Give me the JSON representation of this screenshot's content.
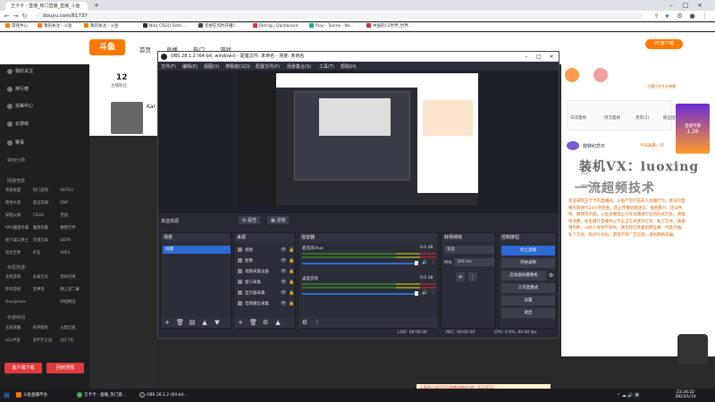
{
  "browser": {
    "tabs": [
      {
        "label": "王卡卡 - 直播_热门直播_直播_斗鱼",
        "active": true
      },
      {
        "label": "王卡卡 - 直播_热门直...",
        "active": false
      }
    ],
    "url": "douyu.com/61737",
    "bookmarks": [
      "游戏中心",
      "我的关注 - 斗鱼",
      "我的关注 - 斗鱼",
      "Nikz CSGO Setti...",
      "您想在何时开播?...",
      "Refrag | Dashboard",
      "Play - Teams - Ne...",
      "中国的CS世界_世界..."
    ]
  },
  "douyu": {
    "logo": "斗鱼",
    "nav": [
      "首页",
      "直播",
      "热门",
      "游戏"
    ],
    "sidebar": {
      "items": [
        "我的关注",
        "排行榜",
        "完美中心",
        "云游戏",
        "赛事"
      ],
      "sections": [
        "常用分类",
        "网游竞技",
        "单机热游",
        "手游休闲"
      ],
      "grid1": [
        "英雄联盟",
        "热门游戏",
        "DOTA2",
        "绝地大逃",
        "逃出深渊",
        "DNF",
        "穿越火线",
        "CSGO",
        "逆战",
        "RPG魔兽争霸",
        "魔兽争霸",
        "魔兽世界",
        "地下城与勇士",
        "守望先锋",
        "DOTA",
        "坦克世界",
        "炉石",
        "APEX"
      ],
      "grid2": [
        "主机游戏",
        "永劫无间",
        "使命召唤",
        "怀旧游戏",
        "黑神话",
        "晚上第二幕",
        "Overprime",
        "",
        "环绕精选"
      ],
      "grid3": [
        "王者荣耀",
        "和平精英",
        "火影忍者",
        "LOL手游",
        "金铲铲之战",
        "QQ飞车",
        "COD手游",
        "幻想飞行家",
        "CF手游"
      ],
      "buttons": [
        "客户端下载",
        "回到顶部"
      ]
    },
    "room": {
      "fans_count": "12",
      "fans_label": "主播粉丝",
      "host_name": "Kar..."
    },
    "right_panel": {
      "pc_badge": "PC客户端",
      "pc_sub": "主播正在开启弹幕",
      "tabs": [
        "日流量榜",
        "周流量榜",
        "贵宾(2)",
        "粉丝团"
      ],
      "rank_title": "旋转纪念日",
      "rank_sub": "今日再看一点",
      "user1": "pigff",
      "user2": "网络Along~",
      "watermark1": "装机VX：luoxing",
      "watermark2": "一流超频技术",
      "welcome": "欢迎来到王卡卡的直播间。斗鱼严厉打击非人主播行为，依法对直播内容进行24小时巡查，禁止传播封建迷信、低俗暴力、违法色情、赌博等内容。斗鱼主播禁止引导主播进行任何形式打赏。请理性消费，如主播在直播中以不正当方式诱导打赏、私下交易，请谨慎判断，以防人身财产损失。请勿轻信各类招聘征婚、代练代抽、私下交易、购买礼包码、游戏币等广告信息，谨防网络诈骗。",
      "side_badge": "直播专题",
      "side_badge_sub": "1.26"
    },
    "bottom_gift": "2.68关注成员可在直播间赠送礼物（01/2551）"
  },
  "obs": {
    "title": "OBS 28.1.2 (64-bit, windows) - 配置文件: 未命名 - 场景: 未命名",
    "menu": [
      "文件(F)",
      "编辑(E)",
      "视图(V)",
      "停靠窗口(D)",
      "配置文件(P)",
      "场景集合(S)",
      "工具(T)",
      "帮助(H)"
    ],
    "scene_bar": {
      "label": "未选择源",
      "props": "属性",
      "filters": "滤镜"
    },
    "docks": {
      "scenes": {
        "title": "场景",
        "items": [
          "场景"
        ]
      },
      "sources": {
        "title": "来源",
        "items": [
          "视频",
          "图像",
          "视频采集设备",
          "窗口采集",
          "显示器采集",
          "音频输出采集"
        ]
      },
      "mixer": {
        "title": "混音器",
        "ch1": "麦克风/Aux",
        "ch1_db": "0.0 dB",
        "ch2": "桌面音频",
        "ch2_db": "0.0 dB",
        "scale": [
          "-60",
          "-55",
          "-50",
          "-45",
          "-40",
          "-35",
          "-30",
          "-25",
          "-20",
          "-15",
          "-10",
          "-5",
          "0"
        ]
      },
      "transitions": {
        "title": "转场特效",
        "type": "渐变",
        "duration_label": "时长",
        "duration": "300 ms"
      },
      "controls": {
        "title": "控制按钮",
        "buttons": [
          "停止直播",
          "开始录制",
          "启动虚拟摄像机",
          "工作室模式",
          "设置",
          "退出"
        ]
      }
    },
    "status": {
      "live": "LIVE: 00:00:00",
      "rec": "REC: 00:00:00",
      "cpu": "CPU: 0.6%, 60.00 fps"
    }
  },
  "taskbar": {
    "start": "开始",
    "items": [
      "斗鱼直播平台",
      "王卡卡 - 直播_热门直...",
      "OBS 28.1.2 (64-bit..."
    ],
    "time": "23:34:22",
    "date": "2023/1/14"
  },
  "colors": {
    "accent": "#ff7800",
    "obs_bg": "#272a33",
    "obs_primary": "#2f6bd6",
    "chat_orange": "#e06a00"
  }
}
